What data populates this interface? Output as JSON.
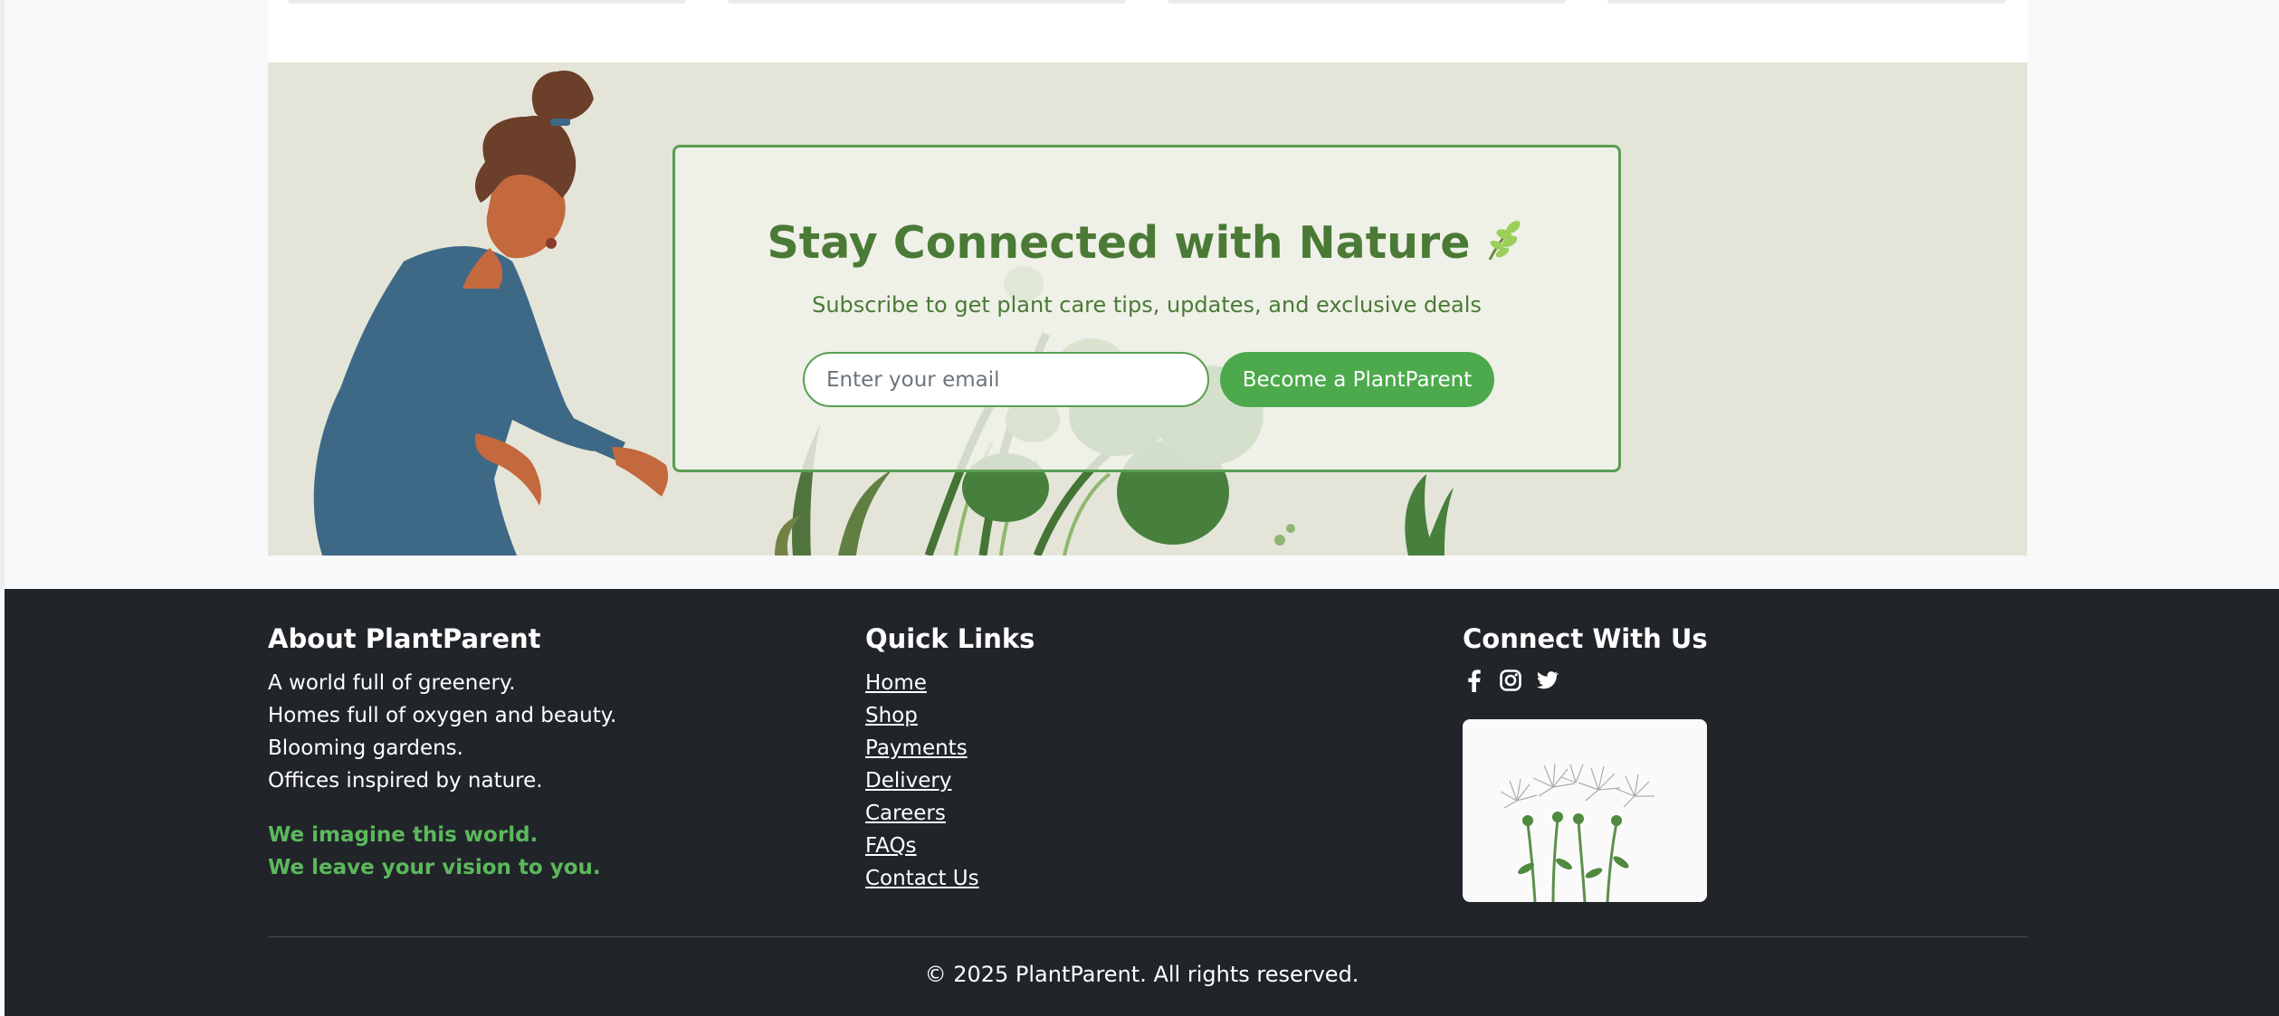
{
  "newsletter": {
    "title": "Stay Connected with Nature",
    "subtitle": "Subscribe to get plant care tips, updates, and exclusive deals",
    "email_placeholder": "Enter your email",
    "button_label": "Become a PlantParent",
    "title_icon": "leaf-icon"
  },
  "footer": {
    "about": {
      "heading": "About PlantParent",
      "lines": [
        "A world full of greenery.",
        "Homes full of oxygen and beauty.",
        "Blooming gardens.",
        "Offices inspired by nature."
      ],
      "highlights": [
        "We imagine this world.",
        "We leave your vision to you."
      ]
    },
    "quick_links": {
      "heading": "Quick Links",
      "links": [
        "Home",
        "Shop",
        "Payments",
        "Delivery",
        "Careers",
        "FAQs",
        "Contact Us"
      ]
    },
    "connect": {
      "heading": "Connect With Us",
      "social_icons": [
        "facebook-icon",
        "instagram-icon",
        "twitter-icon"
      ]
    },
    "copyright": "© 2025 PlantParent. All rights reserved."
  },
  "colors": {
    "brand_green": "#4caa4c",
    "title_green": "#4a7a36",
    "highlight_green": "#5cb85c",
    "footer_bg": "#212529",
    "hero_bg": "#e4e5d8"
  }
}
